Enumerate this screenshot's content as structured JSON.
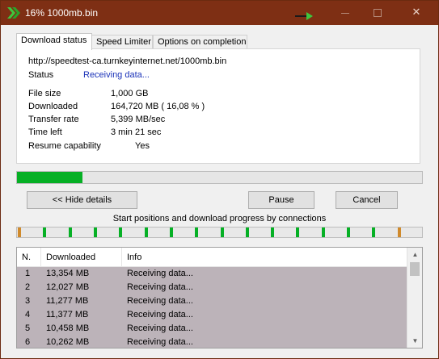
{
  "window": {
    "title": "16% 1000mb.bin",
    "controls": {
      "minimize_icon": "minimize-icon",
      "maximize_icon": "maximize-icon",
      "close_label": "✕"
    }
  },
  "tabs": [
    {
      "label": "Download status",
      "active": true
    },
    {
      "label": "Speed Limiter",
      "active": false
    },
    {
      "label": "Options on completion",
      "active": false
    }
  ],
  "status_panel": {
    "url": "http://speedtest-ca.turnkeyinternet.net/1000mb.bin",
    "status_label": "Status",
    "status_value": "Receiving data...",
    "file_size_label": "File size",
    "file_size_value": "1,000  GB",
    "downloaded_label": "Downloaded",
    "downloaded_value": "164,720  MB  ( 16,08 % )",
    "transfer_rate_label": "Transfer rate",
    "transfer_rate_value": "5,399  MB/sec",
    "time_left_label": "Time left",
    "time_left_value": "3 min 21 sec",
    "resume_label": "Resume capability",
    "resume_value": "Yes"
  },
  "progress": {
    "fraction": 0.1608,
    "color": "#06b025"
  },
  "buttons": {
    "hide_details": "<< Hide details",
    "pause": "Pause",
    "cancel": "Cancel"
  },
  "connections": {
    "caption": "Start positions and download progress by connections",
    "segment_color": "#06b025",
    "marker_color": "#d08a2c",
    "count": 16
  },
  "table": {
    "columns": [
      "N.",
      "Downloaded",
      "Info"
    ],
    "rows": [
      {
        "n": "1",
        "downloaded": "13,354  MB",
        "info": "Receiving data..."
      },
      {
        "n": "2",
        "downloaded": "12,027  MB",
        "info": "Receiving data..."
      },
      {
        "n": "3",
        "downloaded": "11,277  MB",
        "info": "Receiving data..."
      },
      {
        "n": "4",
        "downloaded": "11,377  MB",
        "info": "Receiving data..."
      },
      {
        "n": "5",
        "downloaded": "10,458  MB",
        "info": "Receiving data..."
      },
      {
        "n": "6",
        "downloaded": "10,262  MB",
        "info": "Receiving data..."
      }
    ]
  },
  "colors": {
    "titlebar": "#7e2f14",
    "row_selected": "#bcb3b9",
    "link": "#1a32b8"
  }
}
